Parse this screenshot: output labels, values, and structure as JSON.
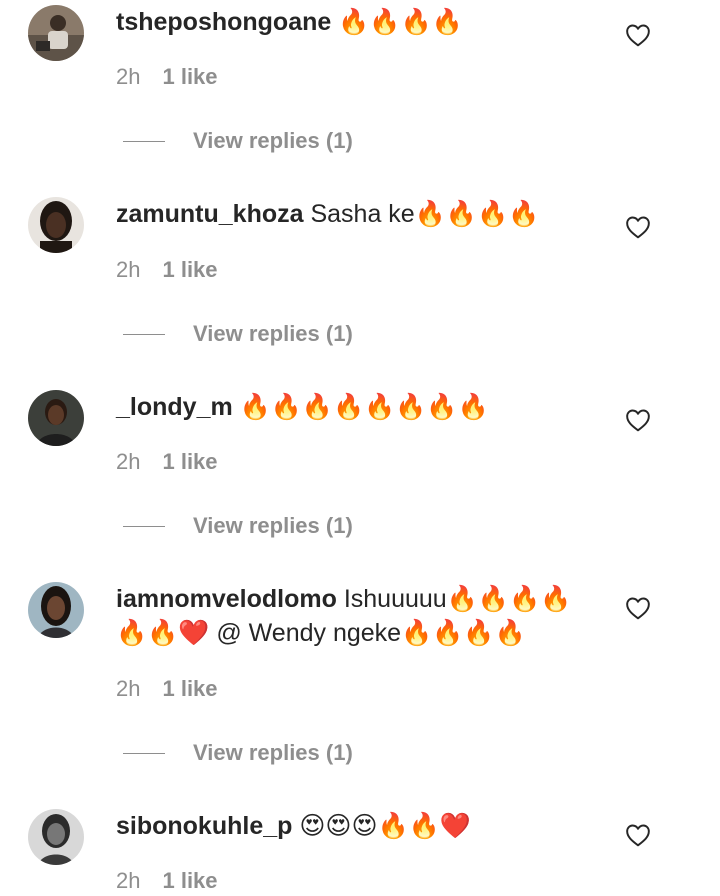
{
  "comments": [
    {
      "username": "tsheposhongoane",
      "text": " 🔥🔥🔥🔥",
      "time": "2h",
      "likes": "1 like",
      "replies": "View replies (1)"
    },
    {
      "username": "zamuntu_khoza",
      "text": " Sasha ke🔥🔥🔥🔥",
      "time": "2h",
      "likes": "1 like",
      "replies": "View replies (1)"
    },
    {
      "username": "_londy_m",
      "text": " 🔥🔥🔥🔥🔥🔥🔥🔥",
      "time": "2h",
      "likes": "1 like",
      "replies": "View replies (1)"
    },
    {
      "username": "iamnomvelodlomo",
      "text": " Ishuuuuu🔥🔥🔥🔥 🔥🔥❤️ @ Wendy ngeke🔥🔥🔥🔥",
      "time": "2h",
      "likes": "1 like",
      "replies": "View replies (1)"
    },
    {
      "username": "sibonokuhle_p",
      "text": " 😍😍😍🔥🔥❤️",
      "time": "2h",
      "likes": "1 like"
    }
  ],
  "icons": {
    "like": "heart-outline-icon"
  },
  "colors": {
    "text": "#262626",
    "secondary": "#8e8e8e"
  }
}
